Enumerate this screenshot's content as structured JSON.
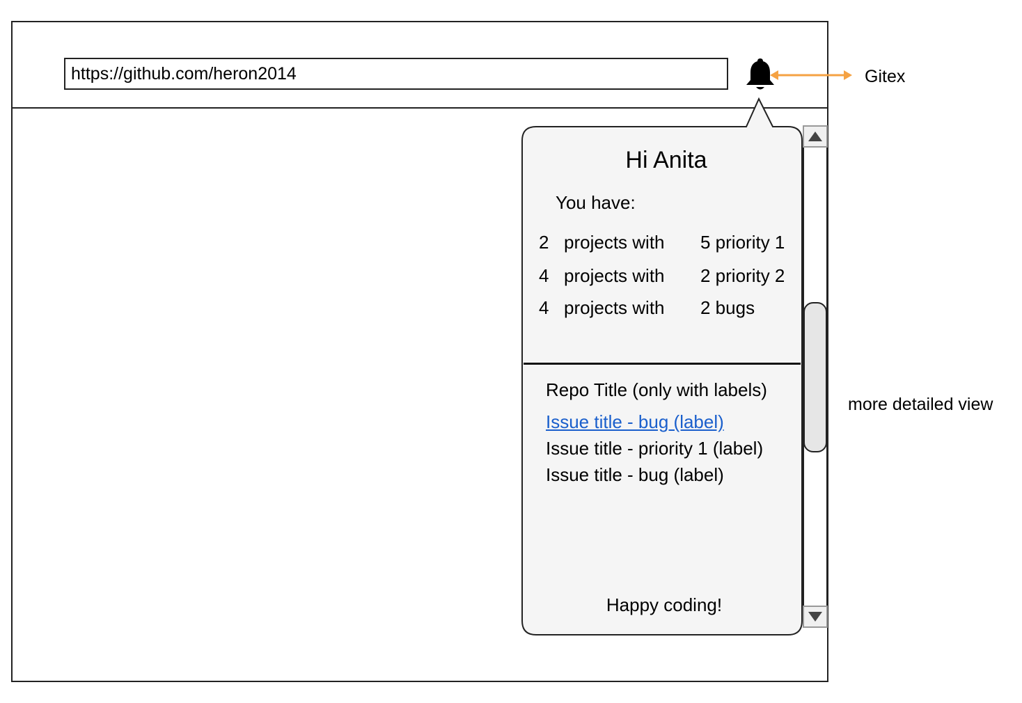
{
  "url_bar": {
    "value": "https://github.com/heron2014"
  },
  "icons": {
    "bell": "bell-icon",
    "scroll_up": "triangle-up-icon",
    "scroll_down": "triangle-down-icon"
  },
  "colors": {
    "arrow": "#f5a243",
    "link": "#1a5fcc",
    "popup_bg": "#f5f5f5"
  },
  "annotations": {
    "gitex": "Gitex",
    "detail_view": "more detailed view"
  },
  "popup": {
    "greeting": "Hi Anita",
    "intro": "You have:",
    "stats": [
      {
        "count": "2",
        "text": "projects with",
        "detail": "5 priority 1"
      },
      {
        "count": "4",
        "text": "projects with",
        "detail": "2 priority 2"
      },
      {
        "count": "4",
        "text": "projects with",
        "detail": "2 bugs"
      }
    ],
    "repo_title": "Repo Title (only with labels)",
    "issues": [
      "Issue title - bug (label)",
      "Issue title - priority 1 (label)",
      "Issue title - bug (label)"
    ],
    "footer": "Happy coding!"
  }
}
